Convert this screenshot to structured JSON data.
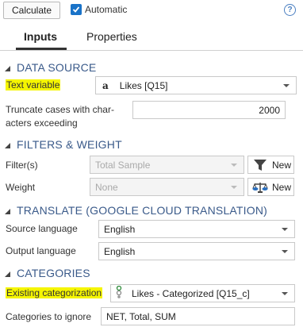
{
  "toolbar": {
    "calculate_label": "Calculate",
    "automatic_label": "Automatic",
    "automatic_checked": true,
    "help_glyph": "?"
  },
  "tabs": [
    {
      "label": "Inputs",
      "active": true
    },
    {
      "label": "Properties",
      "active": false
    }
  ],
  "sections": {
    "data_source": {
      "title": "DATA SOURCE",
      "text_variable_label": "Text variable",
      "text_variable_value": "Likes [Q15]",
      "text_variable_icon": "a",
      "truncate_label_1": "Truncate cases with char-",
      "truncate_label_2": "acters exceeding",
      "truncate_value": "2000"
    },
    "filters_weight": {
      "title": "FILTERS & WEIGHT",
      "filters_label": "Filter(s)",
      "filters_value": "Total Sample",
      "weight_label": "Weight",
      "weight_value": "None",
      "new_filter_label": "New",
      "new_weight_label": "New"
    },
    "translate": {
      "title": "TRANSLATE (GOOGLE CLOUD TRANSLATION)",
      "source_label": "Source language",
      "source_value": "English",
      "output_label": "Output language",
      "output_value": "English"
    },
    "categories": {
      "title": "CATEGORIES",
      "existing_label": "Existing categorization",
      "existing_value": "Likes - Categorized [Q15_c]",
      "ignore_label": "Categories to ignore",
      "ignore_value": "NET, Total, SUM"
    }
  },
  "colors": {
    "highlight": "#f5f500",
    "section_title": "#3a5a8a",
    "checkbox": "#1a73c8"
  }
}
